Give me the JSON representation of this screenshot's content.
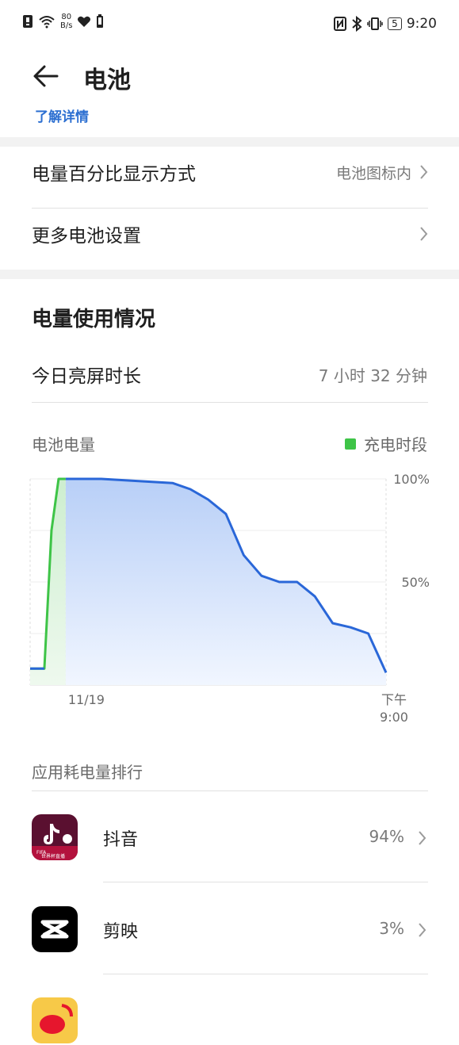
{
  "status_bar": {
    "speed_value": "80",
    "speed_unit": "B/s",
    "battery_badge": "5",
    "time": "9:20",
    "icons": [
      "sim-icon",
      "wifi-icon",
      "heart-icon",
      "battery-small-icon",
      "nfc-icon",
      "bluetooth-icon",
      "vibrate-icon",
      "battery-icon"
    ]
  },
  "header": {
    "title": "电池",
    "partial_link": "了解详情"
  },
  "settings": {
    "percent_display_label": "电量百分比显示方式",
    "percent_display_value": "电池图标内",
    "more_settings_label": "更多电池设置"
  },
  "usage": {
    "section_title": "电量使用情况",
    "screen_time_label": "今日亮屏时长",
    "screen_time_value": "7 小时 32 分钟"
  },
  "chart": {
    "title": "电池电量",
    "legend_label": "充电时段"
  },
  "chart_data": {
    "type": "area",
    "x_ticks": [
      "11/19",
      "下午\n9:00"
    ],
    "y_ticks": [
      "100%",
      "50%"
    ],
    "ylim": [
      0,
      100
    ],
    "series": [
      {
        "name": "充电时段",
        "color": "#3ec447",
        "x": [
          0,
          4,
          6,
          8,
          10
        ],
        "y": [
          8,
          8,
          75,
          100,
          100
        ]
      },
      {
        "color": "#2a67d8",
        "x": [
          10,
          20,
          30,
          40,
          45,
          50,
          55,
          60,
          65,
          70,
          75,
          80,
          85,
          90,
          95,
          100
        ],
        "y": [
          100,
          100,
          99,
          98,
          95,
          90,
          83,
          63,
          53,
          50,
          50,
          43,
          30,
          28,
          25,
          6
        ]
      }
    ],
    "colors": {
      "charge": "#3ec447",
      "line": "#2a67d8",
      "fill": "#cfe0fb"
    }
  },
  "ranking": {
    "title": "应用耗电量排行",
    "apps": [
      {
        "name": "抖音",
        "percent": "94%",
        "icon": "douyin-icon"
      },
      {
        "name": "剪映",
        "percent": "3%",
        "icon": "jianying-icon"
      },
      {
        "name": "",
        "percent": "",
        "icon": "weibo-icon"
      }
    ]
  }
}
